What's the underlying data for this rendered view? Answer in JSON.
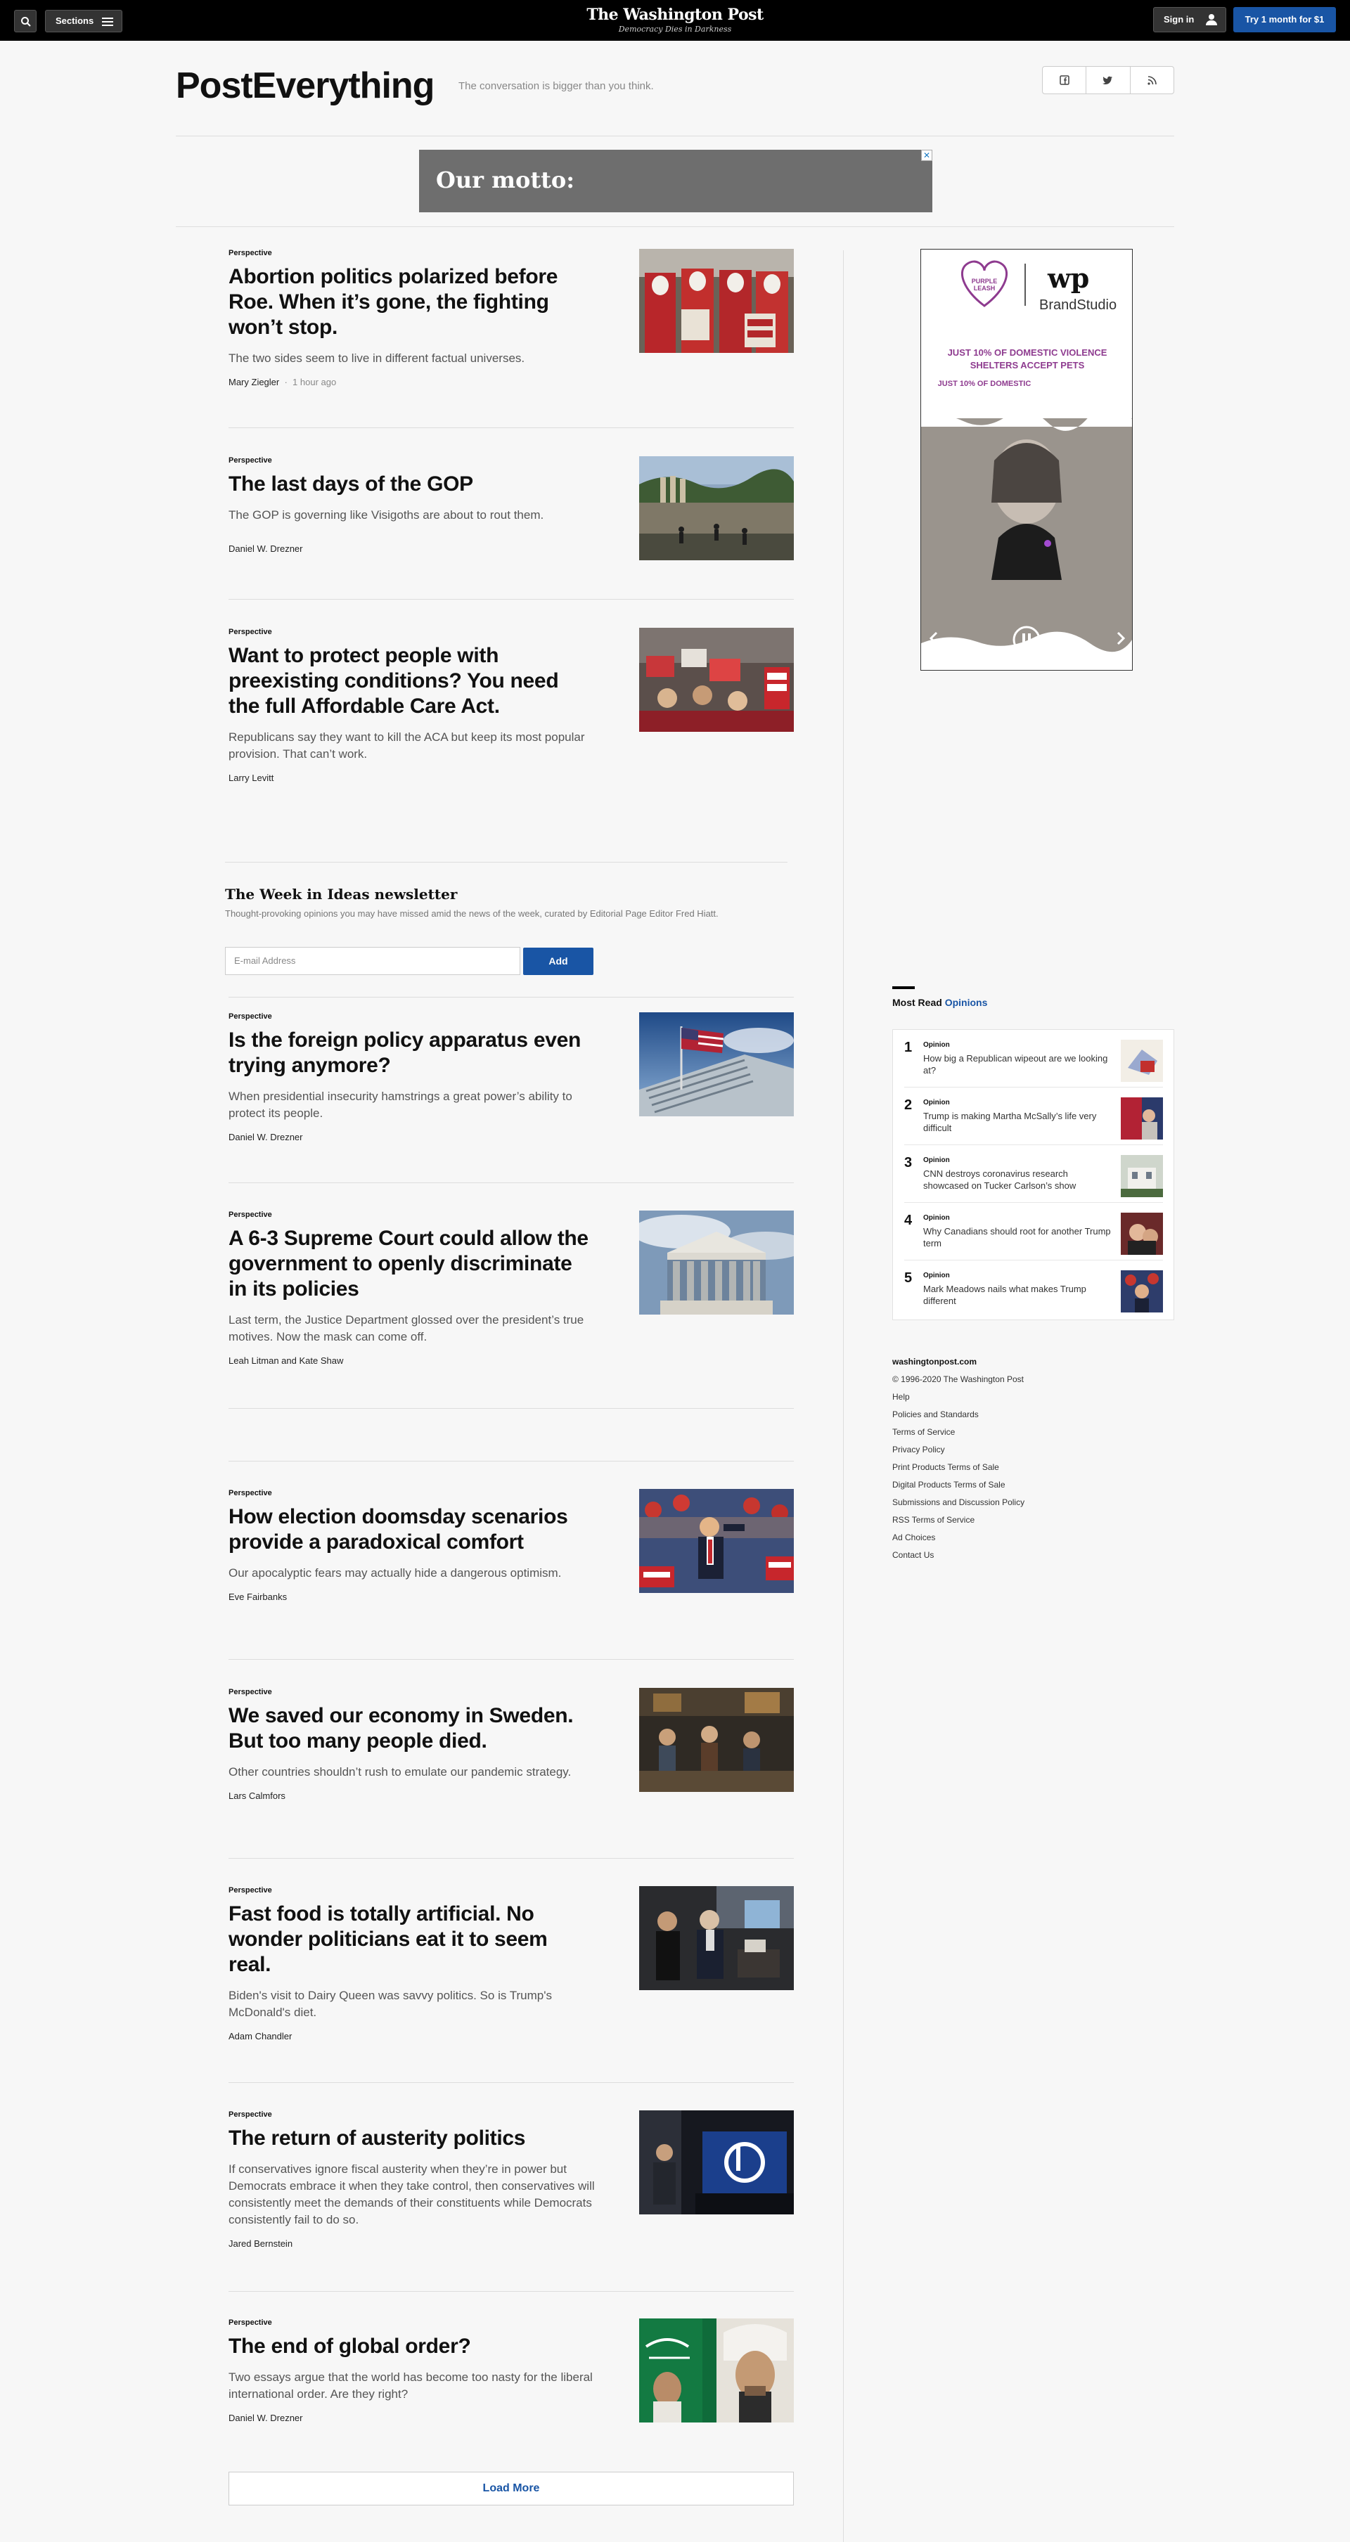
{
  "topbar": {
    "sections_label": "Sections",
    "logo_name": "The Washington Post",
    "logo_tagline": "Democracy Dies in Darkness",
    "signin_label": "Sign in",
    "try_label": "Try 1 month for $1"
  },
  "header": {
    "title": "PostEverything",
    "tagline": "The conversation is bigger than you think."
  },
  "ad_banner": {
    "text": "Our motto:"
  },
  "articles": [
    {
      "label": "Perspective",
      "headline": "Abortion politics polarized before Roe. When it’s gone, the fighting won’t stop.",
      "dek": "The two sides seem to live in different factual universes.",
      "byline": "Mary Ziegler",
      "time": "1 hour ago"
    },
    {
      "label": "Perspective",
      "headline": "The last days of the GOP",
      "dek": "The GOP is governing like Visigoths are about to rout them.",
      "byline": "Daniel W. Drezner"
    },
    {
      "label": "Perspective",
      "headline": "Want to protect people with preexisting conditions? You need the full Affordable Care Act.",
      "dek": "Republicans say they want to kill the ACA but keep its most popular provision. That can’t work.",
      "byline": "Larry Levitt"
    },
    {
      "label": "Perspective",
      "headline": "Is the foreign policy apparatus even trying anymore?",
      "dek": "When presidential insecurity hamstrings a great power’s ability to protect its people.",
      "byline": "Daniel W. Drezner"
    },
    {
      "label": "Perspective",
      "headline": "A 6-3 Supreme Court could allow the government to openly discriminate in its policies",
      "dek": "Last term, the Justice Department glossed over the president’s true motives. Now the mask can come off.",
      "byline": "Leah Litman and Kate Shaw"
    },
    {
      "label": "Perspective",
      "headline": "How election doomsday scenarios provide a paradoxical comfort",
      "dek": "Our apocalyptic fears may actually hide a dangerous optimism.",
      "byline": "Eve Fairbanks"
    },
    {
      "label": "Perspective",
      "headline": "We saved our economy in Sweden. But too many people died.",
      "dek": "Other countries shouldn’t rush to emulate our pandemic strategy.",
      "byline": "Lars Calmfors"
    },
    {
      "label": "Perspective",
      "headline": "Fast food is totally artificial. No wonder politicians eat it to seem real.",
      "dek": "Biden's visit to Dairy Queen was savvy politics. So is Trump's McDonald's diet.",
      "byline": "Adam Chandler"
    },
    {
      "label": "Perspective",
      "headline": "The return of austerity politics",
      "dek": "If conservatives ignore fiscal austerity when they’re in power but Democrats embrace it when they take control, then conservatives will consistently meet the demands of their constituents while Democrats consistently fail to do so.",
      "byline": "Jared Bernstein"
    },
    {
      "label": "Perspective",
      "headline": "The end of global order?",
      "dek": "Two essays argue that the world has become too nasty for the liberal international order. Are they right?",
      "byline": "Daniel W. Drezner"
    }
  ],
  "newsletter": {
    "title": "The Week in Ideas newsletter",
    "description": "Thought-provoking opinions you may have missed amid the news of the week, curated by Editorial Page Editor Fred Hiatt.",
    "placeholder": "E-mail Address",
    "button": "Add"
  },
  "load_more": "Load More",
  "brand_ad": {
    "heart_line1": "PURPLE",
    "heart_line2": "LEASH",
    "wp_mark": "wp",
    "brand": "BrandStudio",
    "headline": "JUST 10% OF DOMESTIC VIOLENCE SHELTERS ACCEPT PETS"
  },
  "most_read": {
    "title": "Most Read",
    "accent": "Opinions",
    "items": [
      {
        "num": "1",
        "label": "Opinion",
        "title": "How big a Republican wipeout are we looking at?"
      },
      {
        "num": "2",
        "label": "Opinion",
        "title": "Trump is making Martha McSally’s life very difficult"
      },
      {
        "num": "3",
        "label": "Opinion",
        "title": "CNN destroys coronavirus research showcased on Tucker Carlson’s show"
      },
      {
        "num": "4",
        "label": "Opinion",
        "title": "Why Canadians should root for another Trump term"
      },
      {
        "num": "5",
        "label": "Opinion",
        "title": "Mark Meadows nails what makes Trump different"
      }
    ]
  },
  "footer": {
    "brand": "washingtonpost.com",
    "copyright": "© 1996-2020 The Washington Post",
    "links": [
      "Help",
      "Policies and Standards",
      "Terms of Service",
      "Privacy Policy",
      "Print Products Terms of Sale",
      "Digital Products Terms of Sale",
      "Submissions and Discussion Policy",
      "RSS Terms of Service",
      "Ad Choices",
      "Contact Us"
    ]
  }
}
